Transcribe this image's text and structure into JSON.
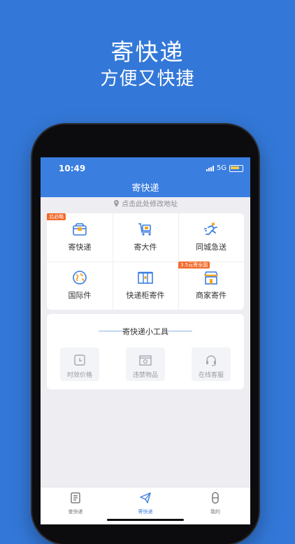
{
  "promo": {
    "title": "寄快递",
    "subtitle": "方便又快捷"
  },
  "status": {
    "time": "10:49",
    "network": "5G"
  },
  "header": {
    "title": "寄快递"
  },
  "address": {
    "hint": "点击此处修改地址",
    "icon": "location-pin-icon"
  },
  "services": [
    {
      "label": "寄快递",
      "icon": "package-box-icon",
      "badge": "北必略"
    },
    {
      "label": "寄大件",
      "icon": "cart-icon"
    },
    {
      "label": "同城急送",
      "icon": "running-courier-icon"
    },
    {
      "label": "国际件",
      "icon": "globe-icon"
    },
    {
      "label": "快递柜寄件",
      "icon": "locker-icon"
    },
    {
      "label": "商家寄件",
      "icon": "store-icon",
      "badge": "3.5元寄全国"
    }
  ],
  "tools": {
    "title": "寄快递小工具",
    "items": [
      {
        "label": "时效价格",
        "icon": "clock-icon"
      },
      {
        "label": "违禁物品",
        "icon": "prohibited-box-icon"
      },
      {
        "label": "在线客服",
        "icon": "headset-icon"
      }
    ]
  },
  "tabbar": [
    {
      "label": "查快递",
      "icon": "document-icon",
      "active": false
    },
    {
      "label": "寄快递",
      "icon": "paper-plane-icon",
      "active": true
    },
    {
      "label": "我的",
      "icon": "user-icon",
      "active": false
    }
  ],
  "colors": {
    "brand": "#3a7ee0",
    "background": "#3378d8",
    "badge": "#f26b2c",
    "icon_orange": "#f5a623"
  }
}
